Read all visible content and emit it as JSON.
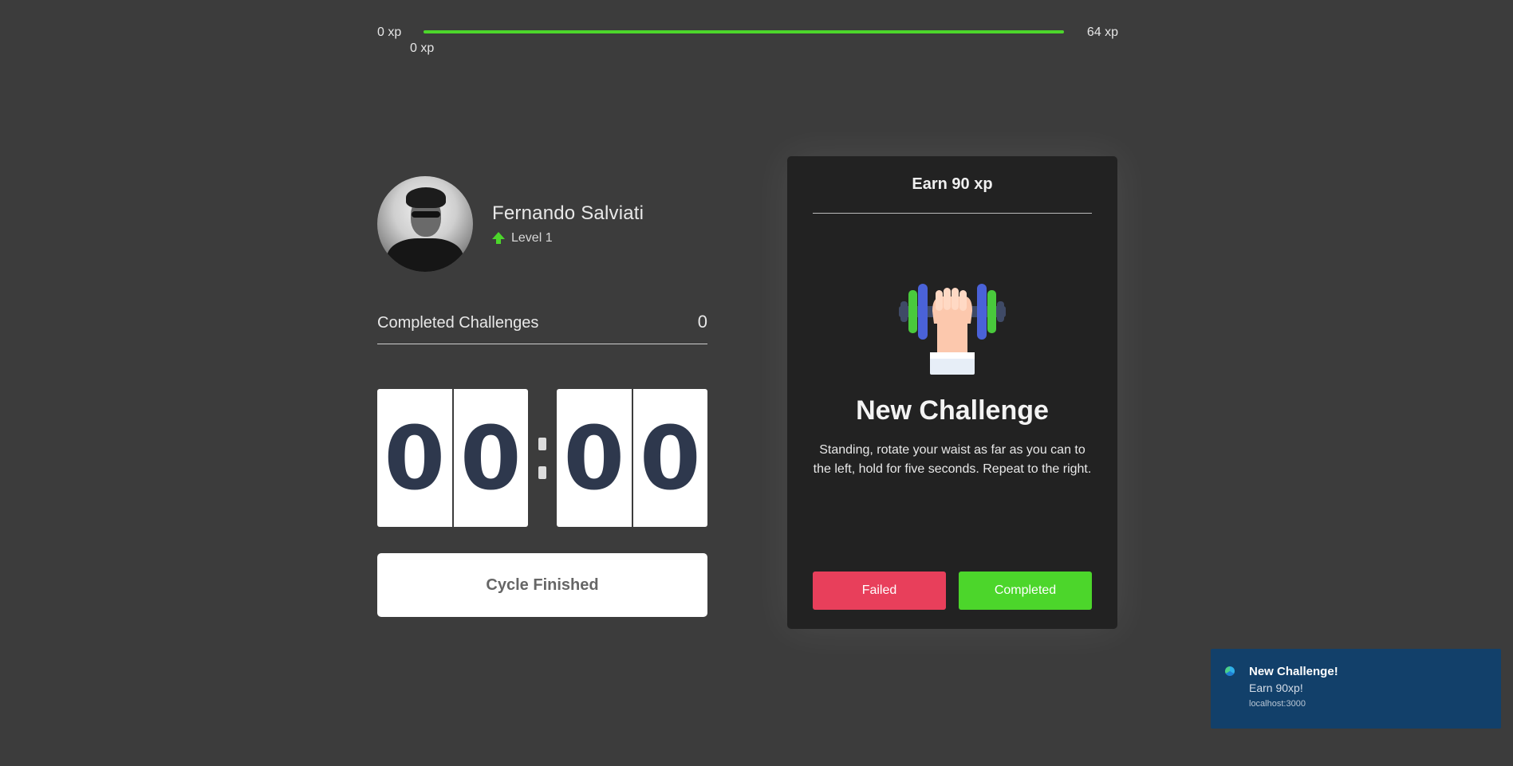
{
  "xp_bar": {
    "min_label": "0 xp",
    "max_label": "64 xp",
    "current_label": "0 xp",
    "fill_fraction": 1.0,
    "fill_color": "#4cd62b"
  },
  "profile": {
    "name": "Fernando Salviati",
    "level_label": "Level 1",
    "avatar_icon": "avatar-photo",
    "level_icon": "level-up-arrow-icon"
  },
  "stats": {
    "completed_label": "Completed Challenges",
    "completed_count": "0"
  },
  "countdown": {
    "minutes_tens": "0",
    "minutes_ones": "0",
    "seconds_tens": "0",
    "seconds_ones": "0"
  },
  "cycle_button": {
    "label": "Cycle Finished"
  },
  "challenge": {
    "header": "Earn 90 xp",
    "icon": "dumbbell-body-icon",
    "title": "New Challenge",
    "description": "Standing, rotate your waist as far as you can to the left, hold for five seconds. Repeat to the right.",
    "failed_label": "Failed",
    "completed_label": "Completed",
    "failed_color": "#e83f5b",
    "completed_color": "#4cd62b"
  },
  "notification": {
    "icon": "browser-edge-icon",
    "title": "New Challenge!",
    "body": "Earn 90xp!",
    "source": "localhost:3000"
  }
}
